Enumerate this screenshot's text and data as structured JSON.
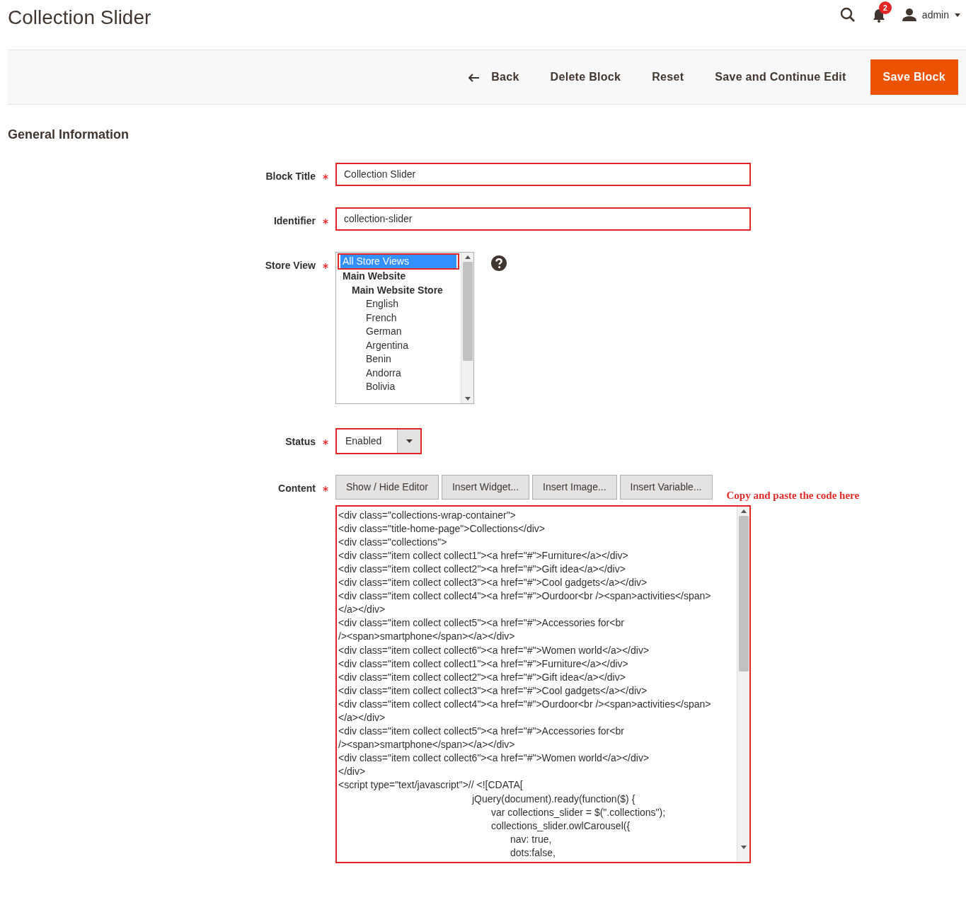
{
  "page_title": "Collection Slider",
  "header": {
    "notifications_count": "2",
    "user": "admin"
  },
  "actions": [
    {
      "label": "Back",
      "kind": "back"
    },
    {
      "label": "Delete Block",
      "kind": "plain"
    },
    {
      "label": "Reset",
      "kind": "plain"
    },
    {
      "label": "Save and Continue Edit",
      "kind": "plain"
    },
    {
      "label": "Save Block",
      "kind": "primary"
    }
  ],
  "section_title": "General Information",
  "fields": [
    {
      "label": "Block Title",
      "required": true,
      "kind": "text",
      "value": "Collection Slider",
      "outlined": true
    },
    {
      "label": "Identifier",
      "required": true,
      "kind": "text",
      "value": "collection-slider",
      "outlined": true
    },
    {
      "label": "Store View",
      "required": true,
      "kind": "multiselect",
      "help": true,
      "options": [
        {
          "label": "All Store Views",
          "kind": "all",
          "selected": true,
          "outlined": true
        },
        {
          "label": "Main Website",
          "kind": "website",
          "selected": false,
          "outlined": false
        },
        {
          "label": "Main Website Store",
          "kind": "store",
          "selected": false,
          "outlined": false
        },
        {
          "label": "English",
          "kind": "view",
          "selected": false,
          "outlined": false
        },
        {
          "label": "French",
          "kind": "view",
          "selected": false,
          "outlined": false
        },
        {
          "label": "German",
          "kind": "view",
          "selected": false,
          "outlined": false
        },
        {
          "label": "Argentina",
          "kind": "view",
          "selected": false,
          "outlined": false
        },
        {
          "label": "Benin",
          "kind": "view",
          "selected": false,
          "outlined": false
        },
        {
          "label": "Andorra",
          "kind": "view",
          "selected": false,
          "outlined": false
        },
        {
          "label": "Bolivia",
          "kind": "view",
          "selected": false,
          "outlined": false
        }
      ]
    },
    {
      "label": "Status",
      "required": true,
      "kind": "select",
      "value": "Enabled",
      "outlined": true
    },
    {
      "label": "Content",
      "required": true,
      "kind": "editor",
      "outlined": true,
      "buttons": [
        "Show / Hide Editor",
        "Insert Widget...",
        "Insert Image...",
        "Insert Variable..."
      ],
      "note": "Copy and paste the code here",
      "lines": [
        "<div class=\"collections-wrap-container\">",
        "<div class=\"title-home-page\">Collections</div>",
        "<div class=\"collections\">",
        "<div class=\"item collect collect1\"><a href=\"#\">Furniture</a></div>",
        "<div class=\"item collect collect2\"><a href=\"#\">Gift idea</a></div>",
        "<div class=\"item collect collect3\"><a href=\"#\">Cool gadgets</a></div>",
        "<div class=\"item collect collect4\"><a href=\"#\">Ourdoor<br /><span>activities</span>",
        "</a></div>",
        "<div class=\"item collect collect5\"><a href=\"#\">Accessories for<br",
        "/><span>smartphone</span></a></div>",
        "<div class=\"item collect collect6\"><a href=\"#\">Women world</a></div>",
        "<div class=\"item collect collect1\"><a href=\"#\">Furniture</a></div>",
        "<div class=\"item collect collect2\"><a href=\"#\">Gift idea</a></div>",
        "<div class=\"item collect collect3\"><a href=\"#\">Cool gadgets</a></div>",
        "<div class=\"item collect collect4\"><a href=\"#\">Ourdoor<br /><span>activities</span>",
        "</a></div>",
        "<div class=\"item collect collect5\"><a href=\"#\">Accessories for<br",
        "/><span>smartphone</span></a></div>",
        "<div class=\"item collect collect6\"><a href=\"#\">Women world</a></div>",
        "</div>",
        "<script type=\"text/javascript\">// <![CDATA[",
        "\t\t\t\t\t\t\tjQuery(document).ready(function($) {",
        "\t\t\t\t\t\t\t\tvar collections_slider = $(\".collections\");",
        "\t\t\t\t\t\t\t\tcollections_slider.owlCarousel({",
        "\t\t\t\t\t\t\t\t\tnav: true,",
        "\t\t\t\t\t\t\t\t\tdots:false,"
      ]
    }
  ]
}
